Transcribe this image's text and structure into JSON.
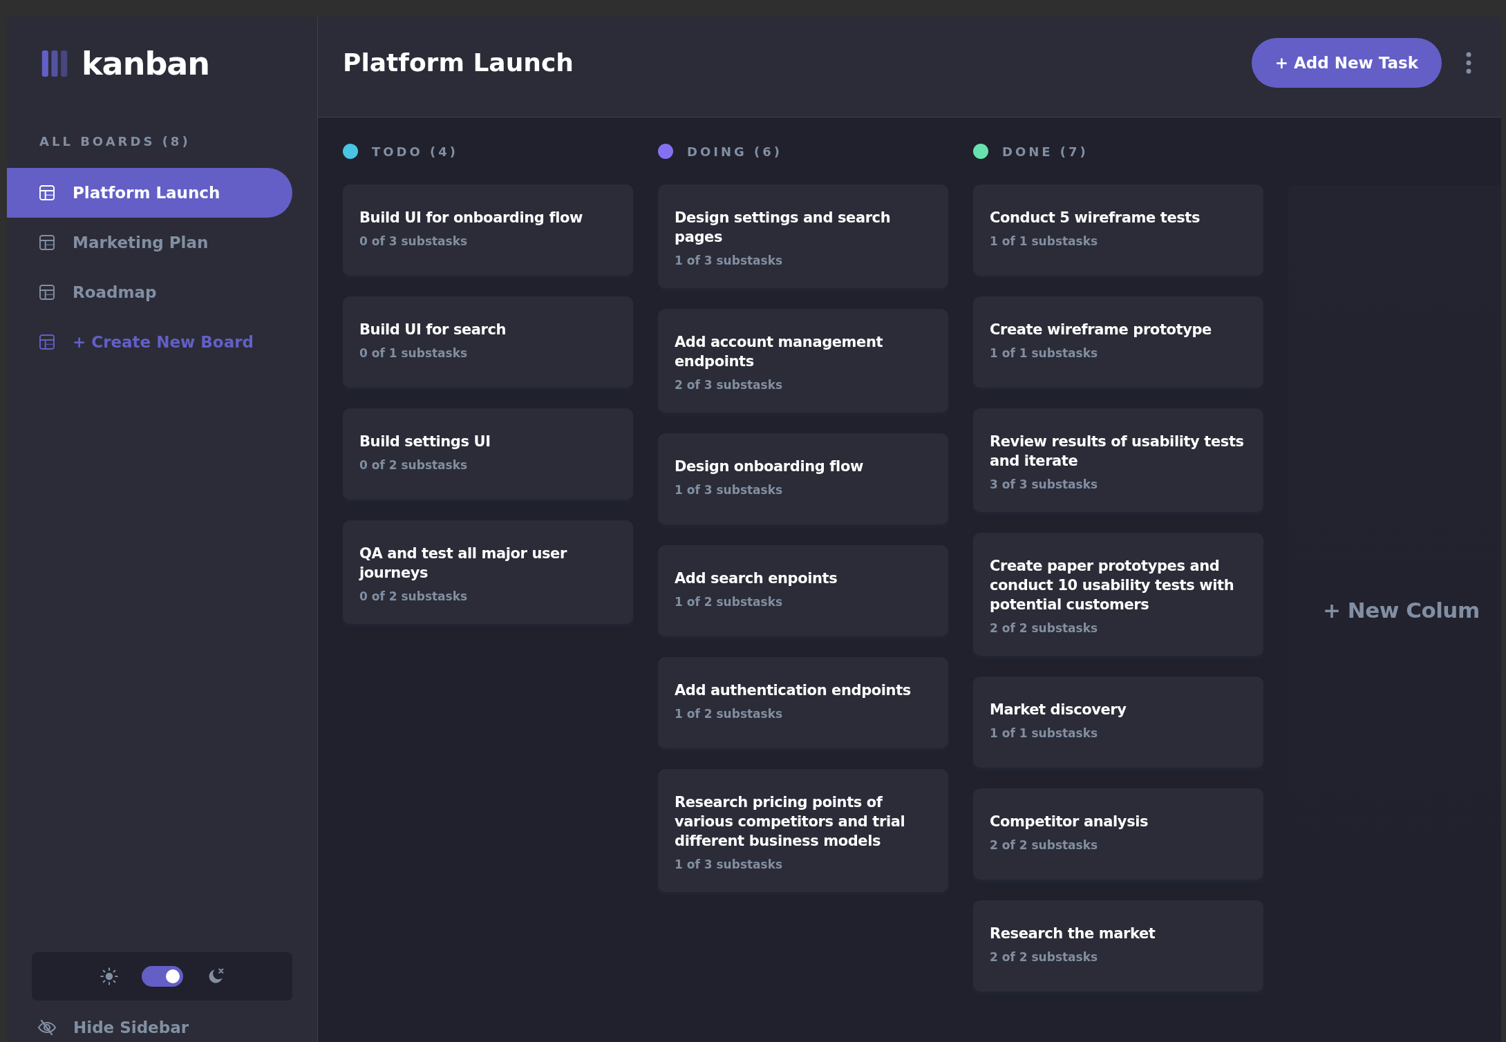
{
  "sidebar": {
    "logo": "kanban",
    "boards_heading": "ALL BOARDS (8)",
    "boards": [
      {
        "name": "Platform Launch",
        "selected": true
      },
      {
        "name": "Marketing Plan",
        "selected": false
      },
      {
        "name": "Roadmap",
        "selected": false
      }
    ],
    "create_board": "+ Create New Board",
    "theme_toggle": {
      "on": true
    },
    "hide_sidebar": "Hide Sidebar"
  },
  "header": {
    "title": "Platform Launch",
    "add_task_button": "+ Add New Task"
  },
  "columns": [
    {
      "name": "TODO (4)",
      "color": "#49c4e5",
      "tasks": [
        {
          "title": "Build UI for onboarding flow",
          "subtasks": "0 of 3 substasks"
        },
        {
          "title": "Build UI for search",
          "subtasks": "0 of 1 substasks"
        },
        {
          "title": "Build settings UI",
          "subtasks": "0 of 2 substasks"
        },
        {
          "title": "QA and test all major user journeys",
          "subtasks": "0 of 2 substasks"
        }
      ]
    },
    {
      "name": "DOING (6)",
      "color": "#8471f2",
      "tasks": [
        {
          "title": "Design settings and search pages",
          "subtasks": "1 of 3 substasks"
        },
        {
          "title": "Add account management endpoints",
          "subtasks": "2 of 3 substasks"
        },
        {
          "title": "Design onboarding flow",
          "subtasks": "1 of 3 substasks"
        },
        {
          "title": "Add search enpoints",
          "subtasks": "1 of 2 substasks"
        },
        {
          "title": "Add authentication endpoints",
          "subtasks": "1 of 2 substasks"
        },
        {
          "title": "Research pricing points of various competitors and trial different business models",
          "subtasks": "1 of 3 substasks"
        }
      ]
    },
    {
      "name": "DONE (7)",
      "color": "#67e2ae",
      "tasks": [
        {
          "title": "Conduct 5 wireframe tests",
          "subtasks": "1 of 1 substasks"
        },
        {
          "title": "Create wireframe prototype",
          "subtasks": "1 of 1 substasks"
        },
        {
          "title": "Review results of usability tests and iterate",
          "subtasks": "3 of 3 substasks"
        },
        {
          "title": "Create paper prototypes and conduct 10 usability tests with potential customers",
          "subtasks": "2 of 2 substasks"
        },
        {
          "title": "Market discovery",
          "subtasks": "1 of 1 substasks"
        },
        {
          "title": "Competitor analysis",
          "subtasks": "2 of 2 substasks"
        },
        {
          "title": "Research the market",
          "subtasks": "2 of 2 substasks"
        }
      ]
    }
  ],
  "new_column": "+ New Colum"
}
